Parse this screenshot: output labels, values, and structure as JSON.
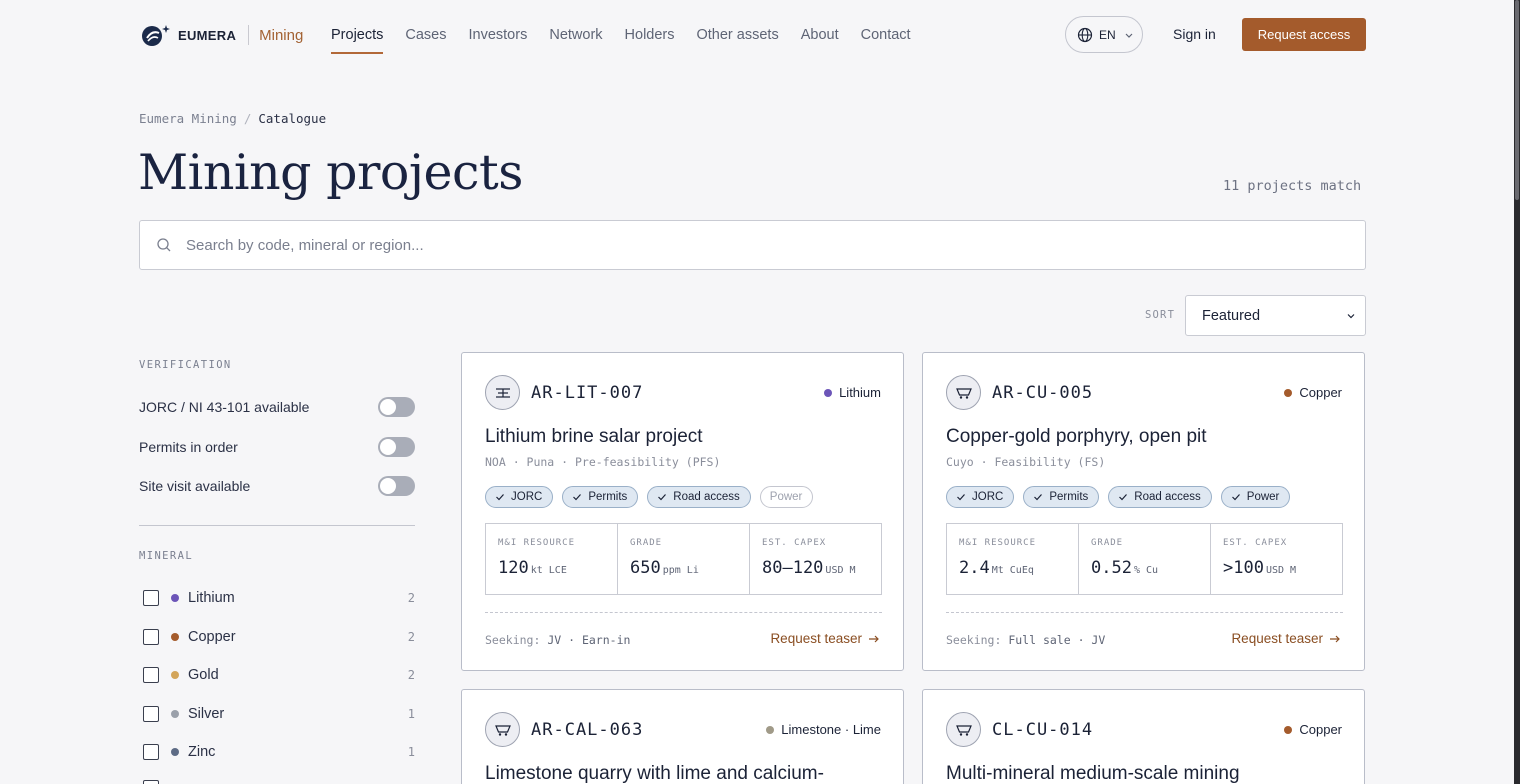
{
  "brand": {
    "name": "EUMERA",
    "section": "Mining"
  },
  "nav": [
    "Projects",
    "Cases",
    "Investors",
    "Network",
    "Holders",
    "Other assets",
    "About",
    "Contact"
  ],
  "header": {
    "lang": "EN",
    "signin": "Sign in",
    "request": "Request access"
  },
  "breadcrumb": {
    "root": "Eumera Mining",
    "sep": "/",
    "current": "Catalogue"
  },
  "page": {
    "title": "Mining projects",
    "match_count": "11 projects match"
  },
  "search": {
    "placeholder": "Search by code, mineral or region..."
  },
  "sort": {
    "label": "SORT",
    "value": "Featured"
  },
  "sidebar": {
    "verification_heading": "VERIFICATION",
    "toggles": [
      "JORC / NI 43-101 available",
      "Permits in order",
      "Site visit available"
    ],
    "mineral_heading": "MINERAL",
    "minerals": [
      {
        "name": "Lithium",
        "count": "2",
        "color": "#6c55b8"
      },
      {
        "name": "Copper",
        "count": "2",
        "color": "#a45b2c"
      },
      {
        "name": "Gold",
        "count": "2",
        "color": "#d3a55a"
      },
      {
        "name": "Silver",
        "count": "1",
        "color": "#9aa0aa"
      },
      {
        "name": "Zinc",
        "count": "1",
        "color": "#5d6b85"
      }
    ]
  },
  "cards": [
    {
      "code": "AR-LIT-007",
      "mineral": "Lithium",
      "mineral_color": "#6c55b8",
      "title": "Lithium brine salar project",
      "meta": "NOA · Puna · Pre-feasibility (PFS)",
      "tags": [
        {
          "label": "JORC",
          "on": true
        },
        {
          "label": "Permits",
          "on": true
        },
        {
          "label": "Road access",
          "on": true
        },
        {
          "label": "Power",
          "on": false
        }
      ],
      "stats": [
        {
          "label": "M&I RESOURCE",
          "value": "120",
          "unit": "kt LCE"
        },
        {
          "label": "GRADE",
          "value": "650",
          "unit": "ppm Li"
        },
        {
          "label": "EST. CAPEX",
          "value": "80–120",
          "unit": "USD M"
        }
      ],
      "seeking_label": "Seeking:",
      "seeking": "JV · Earn-in",
      "teaser": "Request teaser"
    },
    {
      "code": "AR-CU-005",
      "mineral": "Copper",
      "mineral_color": "#a45b2c",
      "title": "Copper-gold porphyry, open pit",
      "meta": "Cuyo · Feasibility (FS)",
      "tags": [
        {
          "label": "JORC",
          "on": true
        },
        {
          "label": "Permits",
          "on": true
        },
        {
          "label": "Road access",
          "on": true
        },
        {
          "label": "Power",
          "on": true
        }
      ],
      "stats": [
        {
          "label": "M&I RESOURCE",
          "value": "2.4",
          "unit": "Mt CuEq"
        },
        {
          "label": "GRADE",
          "value": "0.52",
          "unit": "% Cu"
        },
        {
          "label": "EST. CAPEX",
          "value": ">100",
          "unit": "USD M"
        }
      ],
      "seeking_label": "Seeking:",
      "seeking": "Full sale · JV",
      "teaser": "Request teaser"
    },
    {
      "code": "AR-CAL-063",
      "mineral": "Limestone · Lime",
      "mineral_color": "#a09a88",
      "title": "Limestone quarry with lime and calcium-"
    },
    {
      "code": "CL-CU-014",
      "mineral": "Copper",
      "mineral_color": "#a45b2c",
      "title": "Multi-mineral medium-scale mining"
    }
  ]
}
